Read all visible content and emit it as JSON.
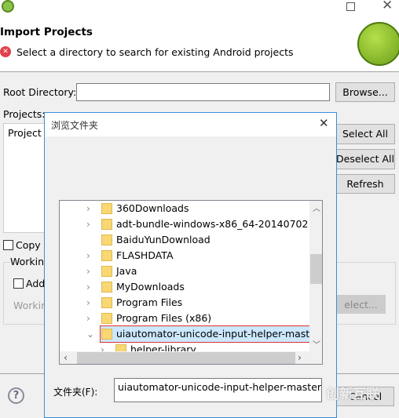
{
  "window": {
    "title": "Import Projects",
    "message": "Select a directory to search for existing Android projects"
  },
  "form": {
    "root_label": "Root Directory:",
    "root_value": "",
    "browse": "Browse...",
    "projects_label": "Projects:",
    "project_col": "Project t",
    "select_all": "Select All",
    "deselect_all": "Deselect All",
    "refresh": "Refresh",
    "copy_label": "Copy p",
    "working_sets": "Workin",
    "add_label": "Add",
    "working_label": "Workin",
    "select_btn": "elect...",
    "cancel": "Cancel"
  },
  "browse_dialog": {
    "title": "浏览文件夹",
    "folder_label": "文件夹(F):",
    "folder_value": "uiautomator-unicode-input-helper-master",
    "tree": [
      {
        "label": "360Downloads",
        "expandable": true
      },
      {
        "label": "adt-bundle-windows-x86_64-20140702",
        "expandable": true
      },
      {
        "label": "BaiduYunDownload",
        "expandable": false
      },
      {
        "label": "FLASHDATA",
        "expandable": true
      },
      {
        "label": "Java",
        "expandable": true
      },
      {
        "label": "MyDownloads",
        "expandable": true
      },
      {
        "label": "Program Files",
        "expandable": true
      },
      {
        "label": "Program Files (x86)",
        "expandable": true
      },
      {
        "label": "uiautomator-unicode-input-helper-master",
        "expandable": true,
        "expanded": true,
        "selected": true
      },
      {
        "label": "helper-library",
        "expandable": true,
        "child": true
      }
    ]
  },
  "watermark": "创新互联",
  "colors": {
    "selection": "#cce8ff",
    "highlight_box": "#e03030",
    "folder": "#f8d775",
    "accent": "#0078d7"
  }
}
